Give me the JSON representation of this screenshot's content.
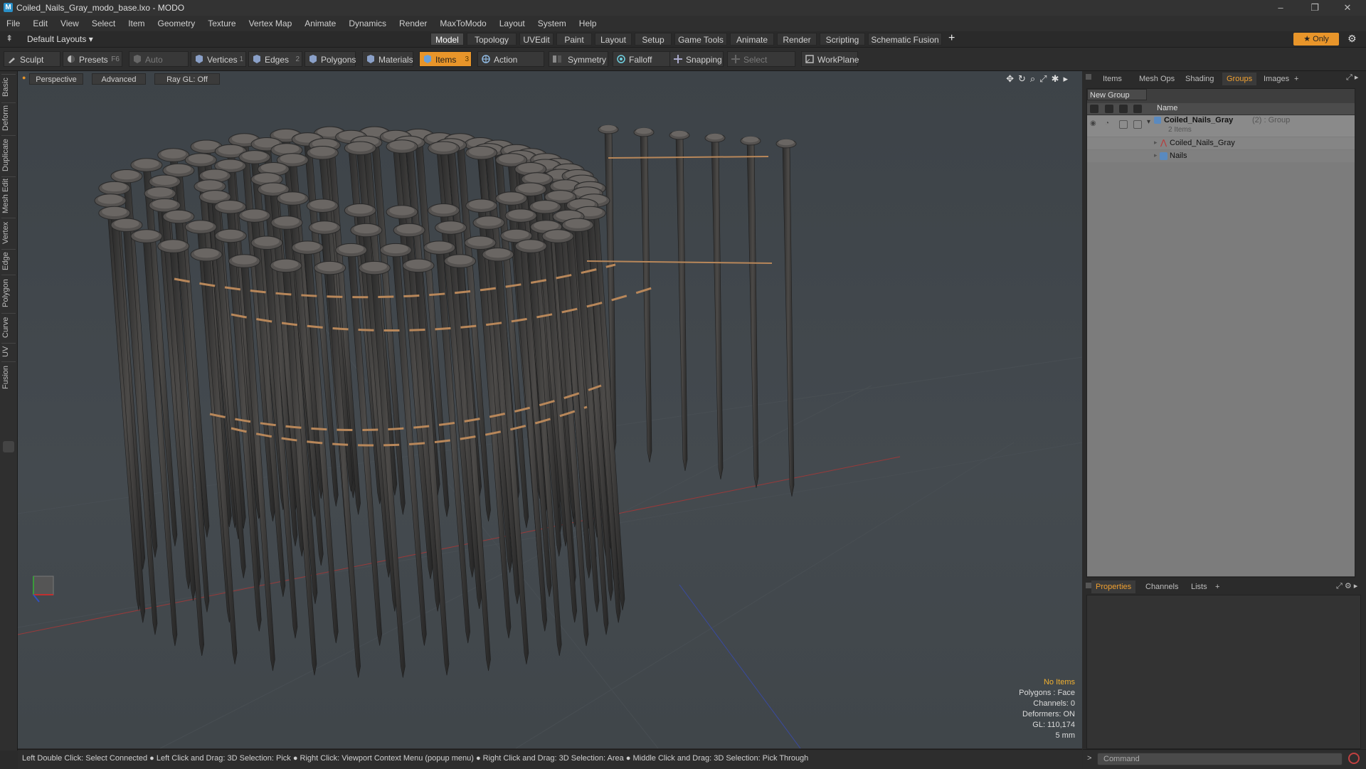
{
  "window": {
    "title": "Coiled_Nails_Gray_modo_base.lxo - MODO",
    "minimize_glyph": "–",
    "restore_glyph": "❐",
    "close_glyph": "✕"
  },
  "menu": [
    "File",
    "Edit",
    "View",
    "Select",
    "Item",
    "Geometry",
    "Texture",
    "Vertex Map",
    "Animate",
    "Dynamics",
    "Render",
    "MaxToModo",
    "Layout",
    "System",
    "Help"
  ],
  "layout_row": {
    "layout_selector": "Default Layouts",
    "tabs": [
      "Model",
      "Topology",
      "UVEdit",
      "Paint",
      "Layout",
      "Setup",
      "Game Tools",
      "Animate",
      "Render",
      "Scripting",
      "Schematic Fusion"
    ],
    "active_tab": "Model",
    "add_tab": "+",
    "only_label": "Only"
  },
  "toolbar": {
    "sculpt": "Sculpt",
    "presets": "Presets",
    "presets_key": "F6",
    "auto_select": "Auto Select",
    "vertices": "Vertices",
    "vertices_count": "1",
    "edges": "Edges",
    "edges_count": "2",
    "polygons": "Polygons",
    "materials": "Materials",
    "items": "Items",
    "items_count": "3",
    "action_center": "Action Center",
    "symmetry": "Symmetry",
    "falloff": "Falloff",
    "snapping": "Snapping",
    "select_through": "Select Through",
    "workplane": "WorkPlane",
    "accent_color": "#e8952a"
  },
  "left_tabs": [
    "Basic",
    "Deform",
    "Duplicate",
    "Mesh Edit",
    "Vertex",
    "Edge",
    "Polygon",
    "Curve",
    "UV",
    "Fusion"
  ],
  "viewport": {
    "view_mode": "Perspective",
    "shading": "Advanced",
    "raygl": "Ray GL: Off",
    "hud": {
      "selection": "No Items",
      "polygons": "Polygons : Face",
      "channels": "Channels: 0",
      "deformers": "Deformers: ON",
      "gl": "GL: 110,174",
      "scale": "5 mm"
    }
  },
  "right_panel": {
    "tabs": [
      "Items",
      "Mesh Ops",
      "Shading",
      "Groups",
      "Images"
    ],
    "active_tab": "Groups",
    "add_tab": "+",
    "new_group": "New Group",
    "column_name": "Name",
    "tree": {
      "group_name": "Coiled_Nails_Gray",
      "group_count": "(2)",
      "group_type": ": Group",
      "group_sub": "2 Items",
      "children": [
        "Coiled_Nails_Gray",
        "Nails"
      ]
    },
    "bottom_tabs": [
      "Properties",
      "Channels",
      "Lists"
    ],
    "bottom_active": "Properties",
    "bottom_add": "+"
  },
  "status": {
    "hint": "Left Double Click: Select Connected ● Left Click and Drag: 3D Selection: Pick ● Right Click: Viewport Context Menu (popup menu) ● Right Click and Drag: 3D Selection: Area ● Middle Click and Drag: 3D Selection: Pick Through"
  },
  "command": {
    "prompt": ">",
    "placeholder": "Command"
  }
}
